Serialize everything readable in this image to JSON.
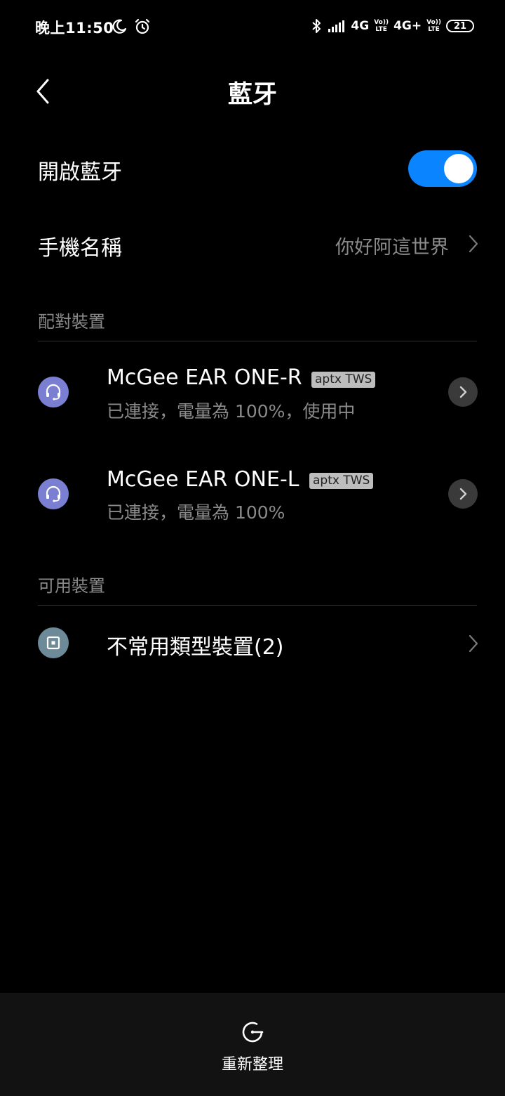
{
  "status_bar": {
    "time": "晚上11:50",
    "network_1": "4G",
    "network_2": "4G+",
    "volte_top": "Vo))",
    "volte_bottom": "LTE",
    "battery": "21",
    "icons": [
      "moon-icon",
      "alarm-icon",
      "bluetooth-icon",
      "signal-icon",
      "battery-icon"
    ]
  },
  "header": {
    "title": "藍牙",
    "back_icon": "chevron-left-icon"
  },
  "bluetooth_toggle": {
    "label": "開啟藍牙",
    "enabled": true,
    "accent_color": "#0a84ff"
  },
  "phone_name": {
    "label": "手機名稱",
    "value": "你好阿這世界"
  },
  "paired_section": {
    "title": "配對裝置",
    "devices": [
      {
        "name": "McGee EAR ONE-R",
        "codec": "aptx TWS",
        "status": "已連接，電量為 100%，使用中",
        "icon": "headset-icon"
      },
      {
        "name": "McGee EAR ONE-L",
        "codec": "aptx TWS",
        "status": "已連接，電量為 100%",
        "icon": "headset-icon"
      }
    ]
  },
  "available_section": {
    "title": "可用裝置",
    "devices": [
      {
        "name": "不常用類型裝置(2)",
        "icon": "generic-device-icon"
      }
    ]
  },
  "bottom_bar": {
    "refresh_label": "重新整理",
    "refresh_icon": "refresh-icon"
  }
}
